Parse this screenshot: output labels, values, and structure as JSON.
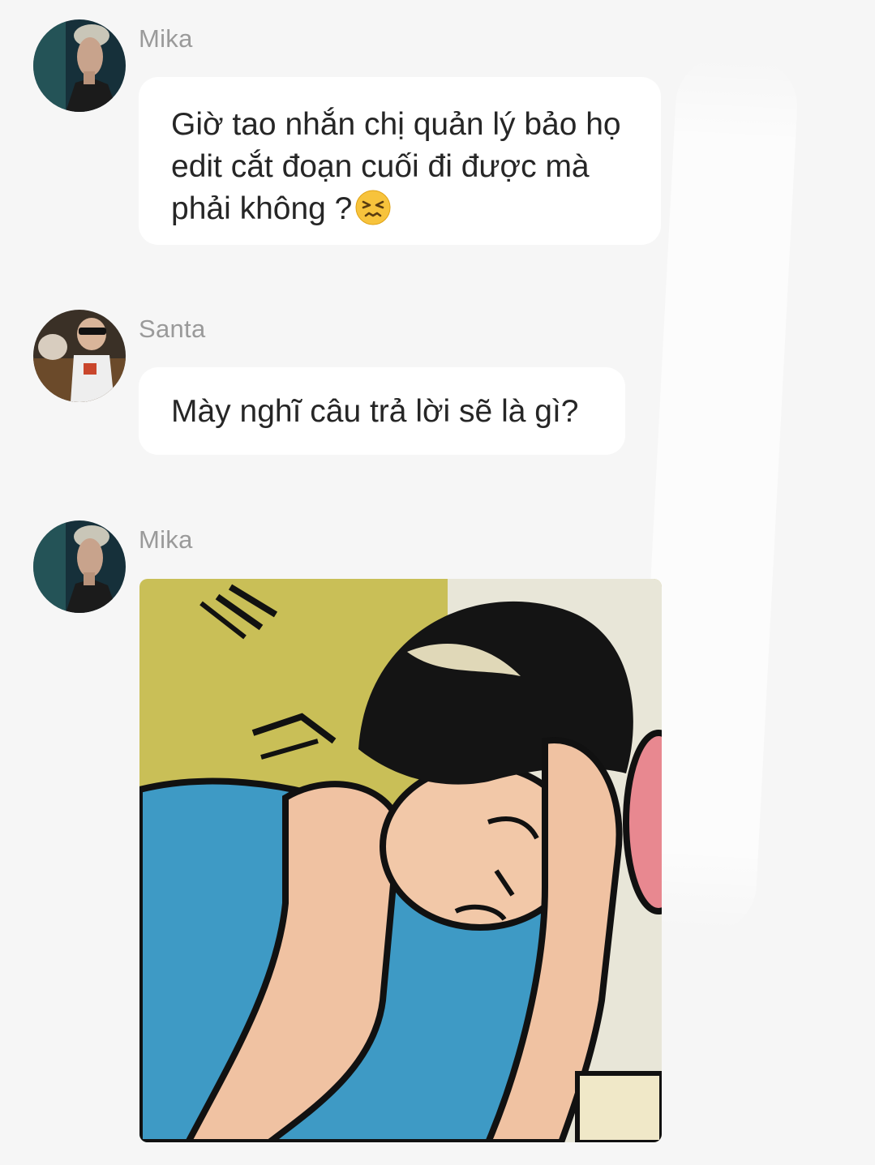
{
  "messages": [
    {
      "sender": "Mika",
      "text": "Giờ tao nhắn chị quản lý bảo họ edit cắt đoạn cuối đi được mà phải không ?",
      "emoji": "persevering-face-emoji"
    },
    {
      "sender": "Santa",
      "text": "Mày nghĩ câu trả lời sẽ là gì?"
    },
    {
      "sender": "Mika",
      "image": "comic-character-holding-head-image"
    }
  ],
  "colors": {
    "background": "#f6f6f6",
    "bubble": "#ffffff",
    "text": "#262626",
    "sender": "#9a9a9a"
  }
}
